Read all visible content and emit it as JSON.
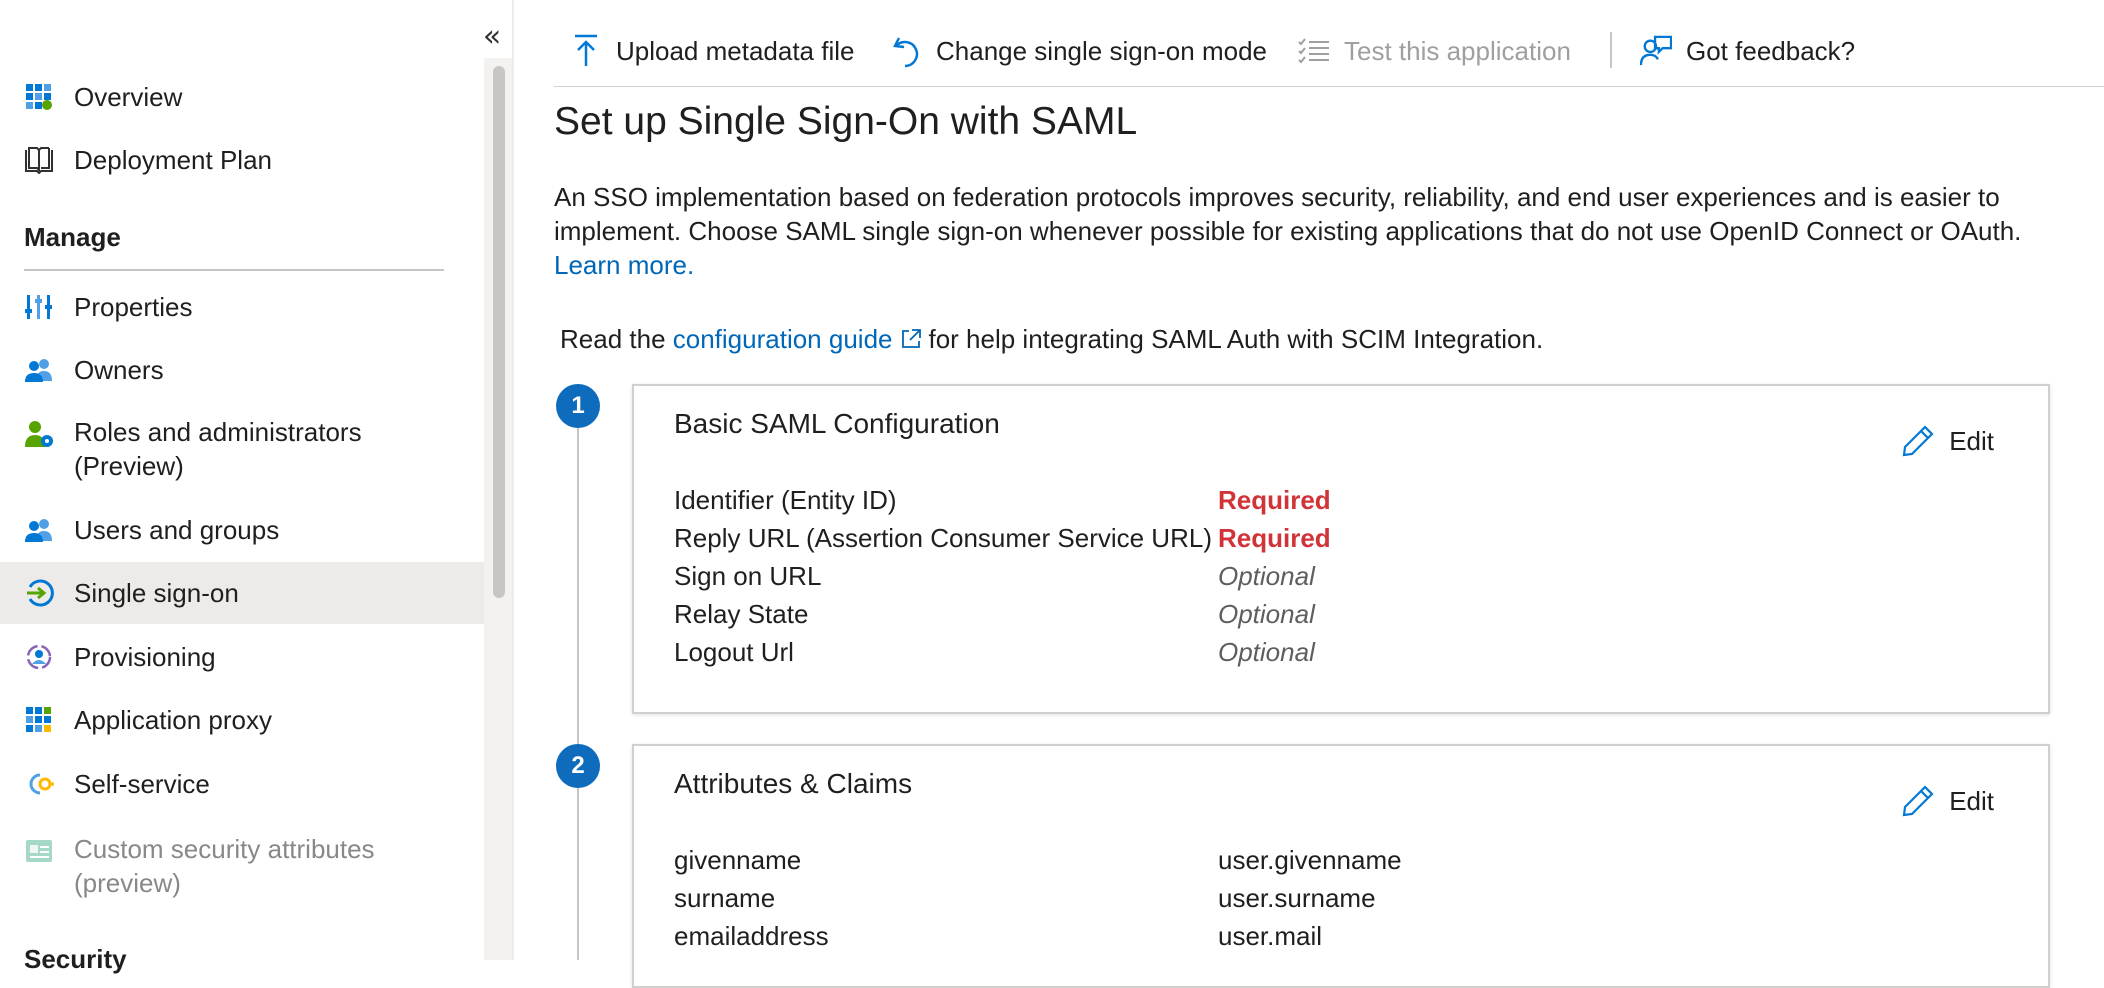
{
  "sidebar": {
    "items": [
      {
        "label": "Overview",
        "icon": "overview-grid-icon"
      },
      {
        "label": "Deployment Plan",
        "icon": "book-icon"
      },
      {
        "label": "Properties",
        "icon": "properties-icon"
      },
      {
        "label": "Owners",
        "icon": "owners-icon"
      },
      {
        "label": "Roles and administrators (Preview)",
        "icon": "roles-icon"
      },
      {
        "label": "Users and groups",
        "icon": "users-icon"
      },
      {
        "label": "Single sign-on",
        "icon": "sso-icon",
        "selected": true
      },
      {
        "label": "Provisioning",
        "icon": "provisioning-icon"
      },
      {
        "label": "Application proxy",
        "icon": "app-proxy-icon"
      },
      {
        "label": "Self-service",
        "icon": "self-service-icon"
      },
      {
        "label": "Custom security attributes (preview)",
        "icon": "custom-attributes-icon",
        "disabled": true
      }
    ],
    "sections": {
      "manage": "Manage",
      "security": "Security"
    },
    "collapse_glyph": "«"
  },
  "toolbar": {
    "upload": "Upload metadata file",
    "change_mode": "Change single sign-on mode",
    "test": "Test this application",
    "feedback": "Got feedback?"
  },
  "main": {
    "title": "Set up Single Sign-On with SAML",
    "intro": "An SSO implementation based on federation protocols improves security, reliability, and end user experiences and is easier to implement. Choose SAML single sign-on whenever possible for existing applications that do not use OpenID Connect or OAuth.",
    "learn_more": "Learn more.",
    "guide_prefix": "Read the",
    "guide_link": "configuration guide",
    "guide_suffix": "for help integrating SAML Auth with SCIM Integration."
  },
  "steps": [
    {
      "number": "1",
      "title": "Basic SAML Configuration",
      "edit": "Edit",
      "rows": [
        {
          "key": "Identifier (Entity ID)",
          "value": "Required",
          "status": "required"
        },
        {
          "key": "Reply URL (Assertion Consumer Service URL)",
          "value": "Required",
          "status": "required"
        },
        {
          "key": "Sign on URL",
          "value": "Optional",
          "status": "optional"
        },
        {
          "key": "Relay State",
          "value": "Optional",
          "status": "optional"
        },
        {
          "key": "Logout Url",
          "value": "Optional",
          "status": "optional"
        }
      ]
    },
    {
      "number": "2",
      "title": "Attributes & Claims",
      "edit": "Edit",
      "rows": [
        {
          "key": "givenname",
          "value": "user.givenname"
        },
        {
          "key": "surname",
          "value": "user.surname"
        },
        {
          "key": "emailaddress",
          "value": "user.mail"
        }
      ]
    }
  ],
  "colors": {
    "accent": "#0067b8",
    "required": "#d13438",
    "selected_bg": "#edebe9",
    "step_badge": "#0f6cbd"
  }
}
